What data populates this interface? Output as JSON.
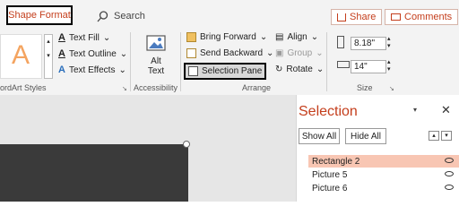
{
  "header": {
    "active_tab": "Shape Format",
    "search_label": "Search",
    "share_label": "Share",
    "comments_label": "Comments"
  },
  "ribbon": {
    "wordart": {
      "group_label": "ordArt Styles",
      "text_fill": "Text Fill",
      "text_outline": "Text Outline",
      "text_effects": "Text Effects"
    },
    "accessibility": {
      "alt_text_line1": "Alt",
      "alt_text_line2": "Text",
      "group_label": "Accessibility"
    },
    "arrange": {
      "bring_forward": "Bring Forward",
      "send_backward": "Send Backward",
      "selection_pane": "Selection Pane",
      "align": "Align",
      "group": "Group",
      "rotate": "Rotate",
      "group_label": "Arrange"
    },
    "size": {
      "height": "8.18\"",
      "width": "14\"",
      "group_label": "Size"
    }
  },
  "selection_pane": {
    "title": "Selection",
    "show_all": "Show All",
    "hide_all": "Hide All",
    "items": [
      {
        "label": "Rectangle 2",
        "selected": true
      },
      {
        "label": "Picture 5",
        "selected": false
      },
      {
        "label": "Picture 6",
        "selected": false
      }
    ]
  },
  "colors": {
    "accent": "#c43e1c",
    "selected_row": "#f8c6b3"
  }
}
